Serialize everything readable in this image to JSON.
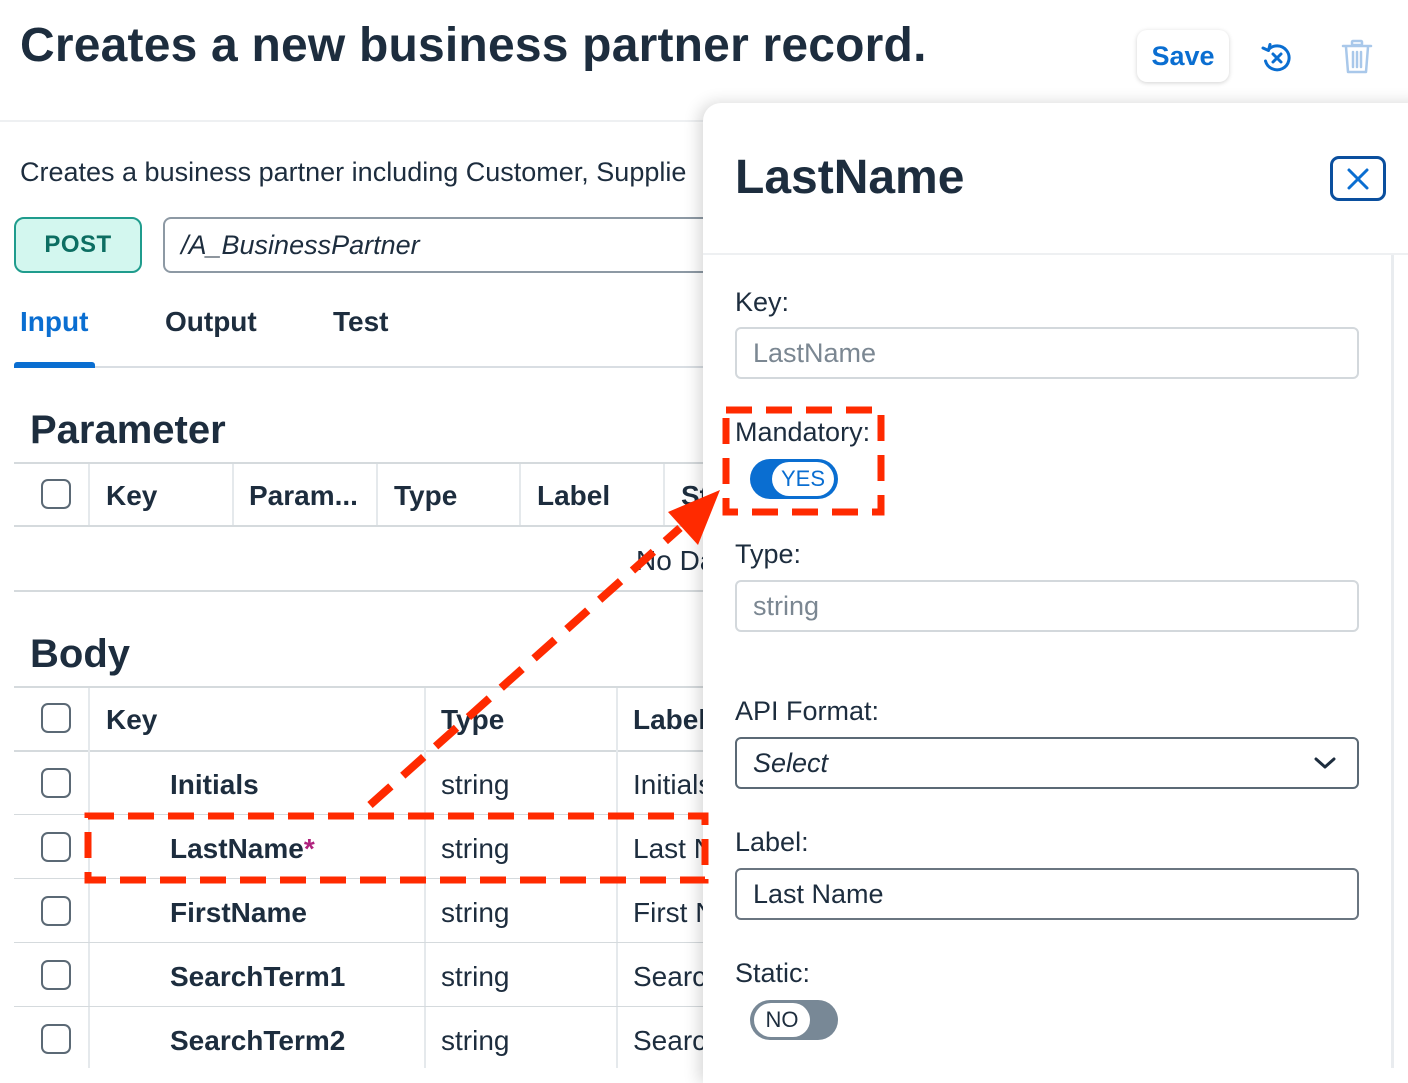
{
  "header": {
    "title": "Creates a new business partner record.",
    "save_label": "Save"
  },
  "description": "Creates a business partner including Customer, Supplie",
  "request": {
    "method": "POST",
    "path": "/A_BusinessPartner"
  },
  "tabs": [
    {
      "label": "Input",
      "active": true
    },
    {
      "label": "Output",
      "active": false
    },
    {
      "label": "Test",
      "active": false
    }
  ],
  "parameter": {
    "title": "Parameter",
    "columns": [
      "Key",
      "Param...",
      "Type",
      "Label",
      "St"
    ],
    "empty_text": "No Da"
  },
  "body": {
    "title": "Body",
    "columns": [
      "Key",
      "Type",
      "Label"
    ],
    "rows": [
      {
        "key": "Initials",
        "type": "string",
        "label": "Initials",
        "required": false
      },
      {
        "key": "LastName",
        "type": "string",
        "label": "Last N",
        "required": true
      },
      {
        "key": "FirstName",
        "type": "string",
        "label": "First N",
        "required": false
      },
      {
        "key": "SearchTerm1",
        "type": "string",
        "label": "Searc",
        "required": false
      },
      {
        "key": "SearchTerm2",
        "type": "string",
        "label": "Searc",
        "required": false
      }
    ]
  },
  "panel": {
    "title": "LastName",
    "key_label": "Key:",
    "key_value": "LastName",
    "mandatory_label": "Mandatory:",
    "mandatory_value": "YES",
    "type_label": "Type:",
    "type_value": "string",
    "api_format_label": "API Format:",
    "api_format_value": "Select",
    "label_label": "Label:",
    "label_value": "Last Name",
    "static_label": "Static:",
    "static_value": "NO"
  },
  "colors": {
    "accent": "#0a6ed1",
    "annotation": "#ff2a00",
    "post_badge_bg": "#d3f7ef",
    "required_marker": "#b0227e"
  },
  "icons": {
    "reset": "reset-icon",
    "delete": "trash-icon",
    "close": "close-icon",
    "dropdown": "chevron-down-icon",
    "annotation_arrow": "red-arrow"
  }
}
